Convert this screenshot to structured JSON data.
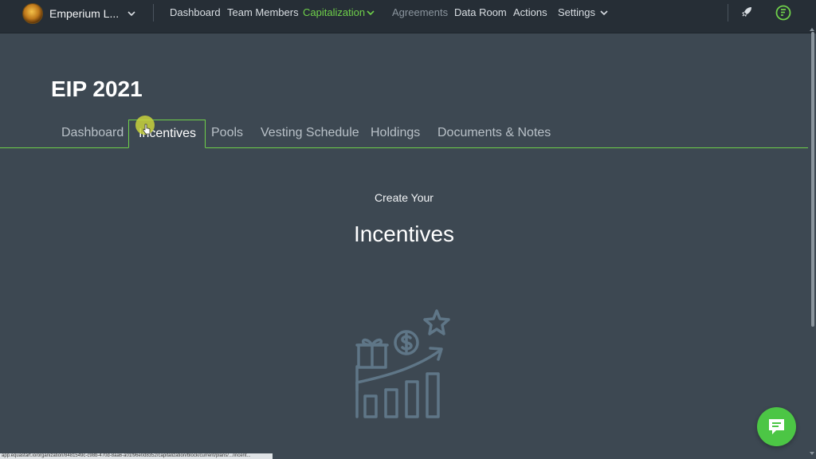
{
  "header": {
    "org_name": "Emperium L...",
    "nav": [
      {
        "label": "Dashboard",
        "state": "normal"
      },
      {
        "label": "Team Members",
        "state": "normal"
      },
      {
        "label": "Capitalization",
        "state": "active"
      },
      {
        "label": "Agreements",
        "state": "disabled"
      },
      {
        "label": "Data Room",
        "state": "normal"
      },
      {
        "label": "Actions",
        "state": "normal"
      },
      {
        "label": "Settings",
        "state": "normal"
      }
    ],
    "icons": [
      "chevron-down-icon",
      "rocket-icon",
      "brand-logo-icon"
    ]
  },
  "page": {
    "title": "EIP 2021",
    "tabs": [
      {
        "label": "Dashboard",
        "active": false
      },
      {
        "label": "Incentives",
        "active": true
      },
      {
        "label": "Pools",
        "active": false
      },
      {
        "label": "Vesting Schedule",
        "active": false
      },
      {
        "label": "Holdings",
        "active": false
      },
      {
        "label": "Documents & Notes",
        "active": false
      }
    ]
  },
  "empty_state": {
    "subtitle": "Create Your",
    "heading": "Incentives",
    "icon": "incentives-growth-illustration"
  },
  "status_bar": {
    "url": "app.equastart.io/organization/8481549c-c98b-470d-8aa6-a01f96e0d8352/capitalization/block/current/plans/.../incent..."
  },
  "chat": {
    "icon": "chat-icon"
  },
  "colors": {
    "accent": "#6fd04a",
    "nav_bg": "#262e36",
    "page_bg": "#3d4852",
    "chat_bg": "#4cc645"
  }
}
